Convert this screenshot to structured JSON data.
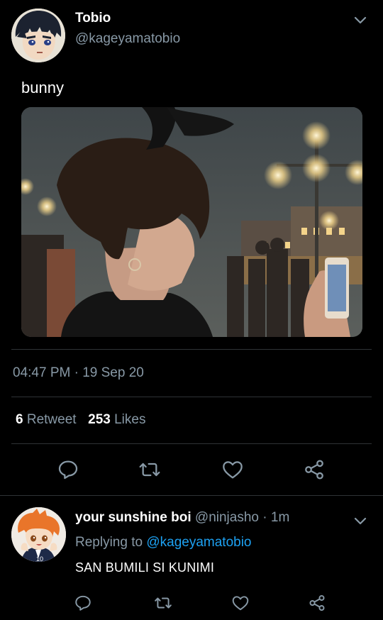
{
  "tweet": {
    "author_name": "Tobio",
    "author_handle": "@kageyamatobio",
    "text": "bunny",
    "time": "04:47 PM",
    "separator": "·",
    "date": "19 Sep 20",
    "retweets_count": "6",
    "retweets_label": "Retweet",
    "likes_count": "253",
    "likes_label": "Likes"
  },
  "reply": {
    "author_name": "your sunshine boi",
    "author_handle": "@ninjasho",
    "separator": "·",
    "age": "1m",
    "replying_prefix": "Replying to",
    "replying_to": "@kageyamatobio",
    "text": "SAN BUMILI SI KUNIMI"
  },
  "icons": {
    "reply": "reply-icon",
    "retweet": "retweet-icon",
    "like": "heart-icon",
    "share": "share-icon",
    "more": "chevron-down-icon"
  },
  "colors": {
    "background": "#000000",
    "primary_text": "#ffffff",
    "secondary_text": "#8899a6",
    "link": "#1da1f2",
    "divider": "#2f3336"
  }
}
